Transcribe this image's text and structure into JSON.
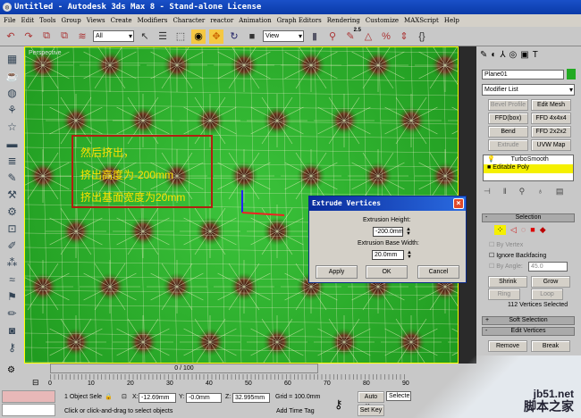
{
  "window": {
    "title": "Untitled - Autodesk 3ds Max 8  - Stand-alone License"
  },
  "menu": [
    "File",
    "Edit",
    "Tools",
    "Group",
    "Views",
    "Create",
    "Modifiers",
    "Character",
    "reactor",
    "Animation",
    "Graph Editors",
    "Rendering",
    "Customize",
    "MAXScript",
    "Help"
  ],
  "toolbar": {
    "selection_filter": "All",
    "reference_coord": "View",
    "snap_angle": "2.5"
  },
  "viewport": {
    "label": "Perspective",
    "annotation": [
      "然后挤出，",
      "挤出高度为-200mm",
      "挤出基面宽度为20mm"
    ]
  },
  "dialog": {
    "title": "Extrude Vertices",
    "height_label": "Extrusion Height:",
    "height_value": "-200.0mm",
    "width_label": "Extrusion Base Width:",
    "width_value": "20.0mm",
    "apply": "Apply",
    "ok": "OK",
    "cancel": "Cancel"
  },
  "panel": {
    "object_name": "Plane01",
    "object_color": "#22aa22",
    "modifier_list": "Modifier List",
    "modifier_buttons": [
      {
        "label": "Bevel Profile",
        "disabled": true
      },
      {
        "label": "Edit Mesh"
      },
      {
        "label": "FFD(box)"
      },
      {
        "label": "FFD 4x4x4"
      },
      {
        "label": "Bend"
      },
      {
        "label": "FFD 2x2x2"
      },
      {
        "label": "Extrude",
        "disabled": true
      },
      {
        "label": "UVW Map"
      }
    ],
    "stack": [
      "TurboSmooth",
      "Editable Poly"
    ],
    "selection": {
      "title": "Selection",
      "by_vertex": "By Vertex",
      "ignore_backfacing": "Ignore Backfacing",
      "by_angle": "By Angle:",
      "angle_value": "45.0",
      "shrink": "Shrink",
      "grow": "Grow",
      "ring": "Ring",
      "loop": "Loop",
      "status": "112 Vertices Selected"
    },
    "soft_selection": "Soft Selection",
    "edit_vertices": "Edit Vertices",
    "remove": "Remove",
    "break": "Break"
  },
  "bottom": {
    "frame": "0 / 100",
    "ticks": [
      "0",
      "10",
      "20",
      "30",
      "40",
      "50",
      "60",
      "70",
      "80",
      "90"
    ],
    "selected": "1 Object Sele",
    "x": "-12.69mm",
    "y": "-0.0mm",
    "z": "32.995mm",
    "grid": "Grid = 100.0mm",
    "prompt": "Click or click-and-drag to select objects",
    "add_time_tag": "Add Time Tag",
    "auto_key": "Auto Key",
    "set_key": "Set Key",
    "key_filter": "Selecte"
  },
  "watermark": {
    "site": "jb51.net",
    "name": "脚本之家"
  }
}
